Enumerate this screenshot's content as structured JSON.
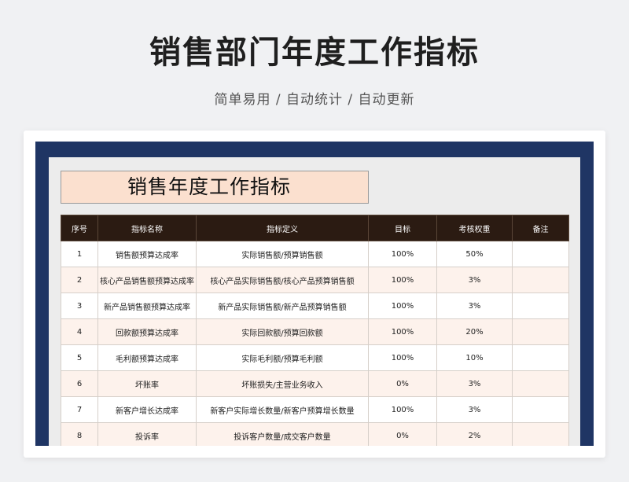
{
  "page": {
    "title": "销售部门年度工作指标",
    "subtitle": "简单易用 / 自动统计 / 自动更新"
  },
  "sheet": {
    "title": "销售年度工作指标",
    "columns": [
      "序号",
      "指标名称",
      "指标定义",
      "目标",
      "考核权重",
      "备注"
    ],
    "rows": [
      {
        "no": "1",
        "name": "销售额预算达成率",
        "definition": "实际销售额/预算销售额",
        "target": "100%",
        "weight": "50%",
        "note": ""
      },
      {
        "no": "2",
        "name": "核心产品销售额预算达成率",
        "definition": "核心产品实际销售额/核心产品预算销售额",
        "target": "100%",
        "weight": "3%",
        "note": ""
      },
      {
        "no": "3",
        "name": "新产品销售额预算达成率",
        "definition": "新产品实际销售额/新产品预算销售额",
        "target": "100%",
        "weight": "3%",
        "note": ""
      },
      {
        "no": "4",
        "name": "回款额预算达成率",
        "definition": "实际回款额/预算回款额",
        "target": "100%",
        "weight": "20%",
        "note": ""
      },
      {
        "no": "5",
        "name": "毛利额预算达成率",
        "definition": "实际毛利额/预算毛利额",
        "target": "100%",
        "weight": "10%",
        "note": ""
      },
      {
        "no": "6",
        "name": "坏账率",
        "definition": "坏账损失/主营业务收入",
        "target": "0%",
        "weight": "3%",
        "note": ""
      },
      {
        "no": "7",
        "name": "新客户增长达成率",
        "definition": "新客户实际增长数量/新客户预算增长数量",
        "target": "100%",
        "weight": "3%",
        "note": ""
      },
      {
        "no": "8",
        "name": "投诉率",
        "definition": "投诉客户数量/成交客户数量",
        "target": "0%",
        "weight": "2%",
        "note": ""
      }
    ]
  },
  "colors": {
    "frame": "#1f3564",
    "header_bg": "#2b1b12",
    "title_bg": "#fbe0cf",
    "row_alt": "#fdf2ec"
  }
}
